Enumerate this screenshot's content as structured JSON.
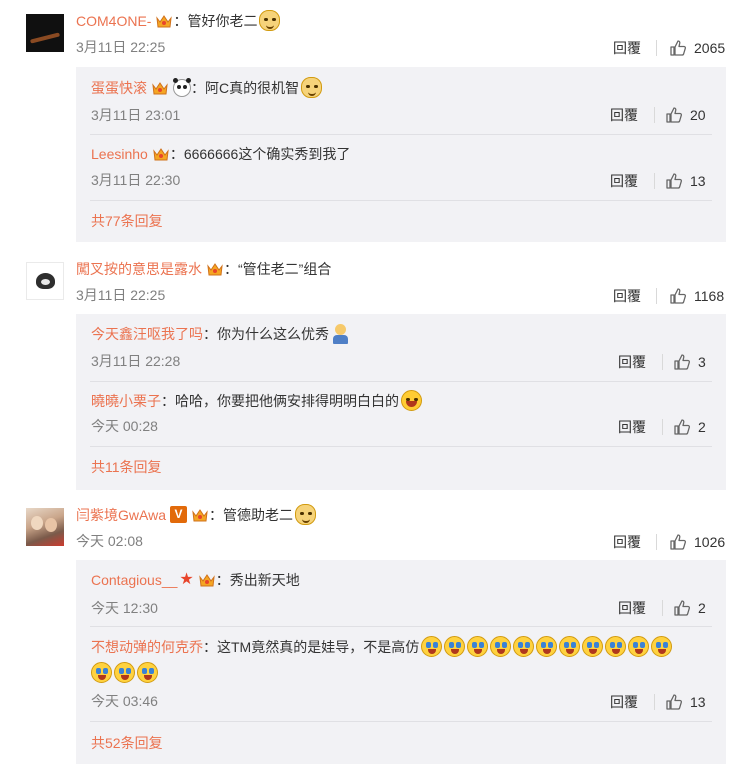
{
  "comments": [
    {
      "user": "COM4ONE-",
      "text": "管好你老二",
      "time": "3月11日 22:25",
      "reply_label": "回覆",
      "likes": "2065",
      "replies": [
        {
          "user": "蛋蛋快滚",
          "text": "阿C真的很机智",
          "time": "3月11日 23:01",
          "reply_label": "回覆",
          "likes": "20"
        },
        {
          "user": "Leesinho",
          "text": "6666666这个确实秀到我了",
          "time": "3月11日 22:30",
          "reply_label": "回覆",
          "likes": "13"
        }
      ],
      "more": "共77条回复"
    },
    {
      "user": "闖叉按的意思是露水",
      "text": "“管住老二”组合",
      "time": "3月11日 22:25",
      "reply_label": "回覆",
      "likes": "1168",
      "replies": [
        {
          "user": "今天鑫汪呕我了吗",
          "text": "你为什么这么优秀",
          "time": "3月11日 22:28",
          "reply_label": "回覆",
          "likes": "3"
        },
        {
          "user": "曉曉小栗子",
          "text": "哈哈，你要把他俩安排得明明白白的",
          "time": "今天 00:28",
          "reply_label": "回覆",
          "likes": "2"
        }
      ],
      "more": "共11条回复"
    },
    {
      "user": "闫紫境GwAwa",
      "verified": "V",
      "text": "管德助老二",
      "time": "今天 02:08",
      "reply_label": "回覆",
      "likes": "1026",
      "replies": [
        {
          "user": "Contagious__",
          "star": "★",
          "text": "秀出新天地",
          "time": "今天 12:30",
          "reply_label": "回覆",
          "likes": "2"
        },
        {
          "user": "不想动弹的何克乔",
          "text": "这TM竟然真的是娃导，不是高仿",
          "time": "今天 03:46",
          "reply_label": "回覆",
          "likes": "13"
        }
      ],
      "more": "共52条回复"
    }
  ],
  "colon": "：",
  "icons": {
    "like": "thumbs-up-icon",
    "member_badge": "crown-badge-icon",
    "doge": "doge-emoji-icon",
    "panda": "panda-emoji-icon",
    "cry_laugh": "laugh-cry-emoji-icon"
  },
  "colors": {
    "username": "#eb7350",
    "text": "#333333",
    "time": "#808080",
    "reply_box": "#f2f2f5"
  }
}
